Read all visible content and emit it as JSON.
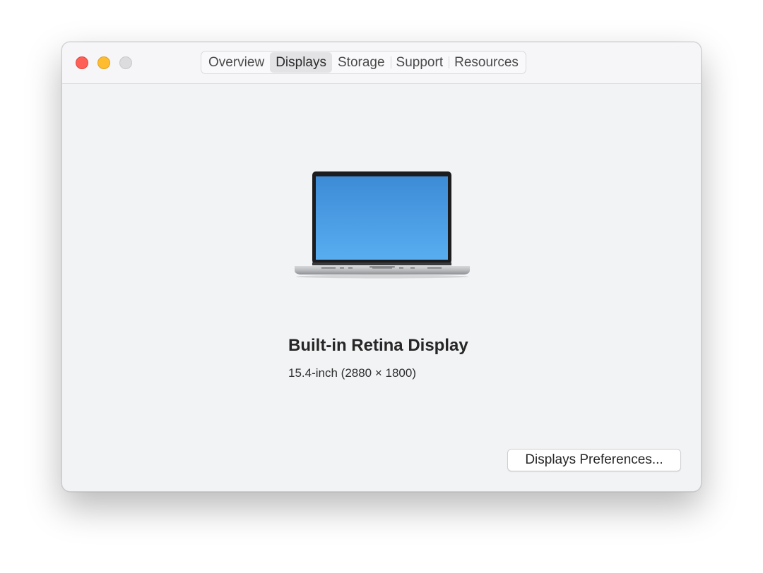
{
  "window": {
    "controls": {
      "close": "close-button",
      "minimize": "minimize-button",
      "zoom": "zoom-button"
    }
  },
  "tabs": [
    {
      "label": "Overview",
      "active": false
    },
    {
      "label": "Displays",
      "active": true
    },
    {
      "label": "Storage",
      "active": false
    },
    {
      "label": "Support",
      "active": false
    },
    {
      "label": "Resources",
      "active": false
    }
  ],
  "display": {
    "icon": "laptop-icon",
    "name": "Built-in Retina Display",
    "spec": "15.4-inch (2880 × 1800)"
  },
  "buttons": {
    "preferences_label": "Displays Preferences..."
  },
  "colors": {
    "close": "#fe5f57",
    "minimize": "#febc2e",
    "zoom_inactive": "#dcdcde",
    "screen_top": "#3d8bd6",
    "screen_bottom": "#58adf0"
  }
}
